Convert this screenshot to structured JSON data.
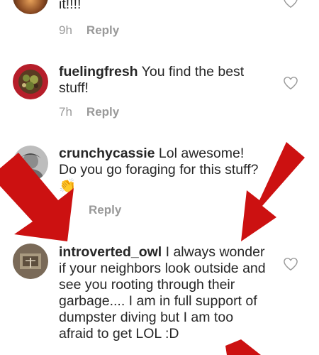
{
  "comments": [
    {
      "username": "",
      "text": "it!!!!",
      "time": "9h",
      "reply_label": "Reply"
    },
    {
      "username": "fuelingfresh",
      "text": " You find the best stuff!",
      "time": "7h",
      "reply_label": "Reply"
    },
    {
      "username": "crunchycassie",
      "text": " Lol awesome! Do you go foraging for this stuff? 👏",
      "time": "",
      "reply_label": "Reply"
    },
    {
      "username": "introverted_owl",
      "text": " I always wonder if your neighbors look outside and see you rooting through their garbage.... I am in full support of dumpster diving but I am too afraid to get LOL :D"
    }
  ],
  "icons": {
    "like": "heart-outline-icon"
  },
  "colors": {
    "text": "#262626",
    "meta": "#999999",
    "arrow": "#cc1111"
  }
}
